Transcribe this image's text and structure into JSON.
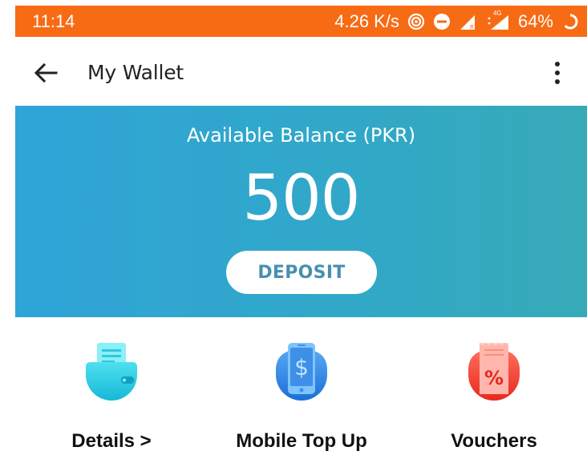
{
  "status_bar": {
    "time": "11:14",
    "speed": "4.26 K/s",
    "network_label": "4G",
    "battery": "64%",
    "icons": [
      "hotspot-icon",
      "dnd-icon",
      "signal-icon",
      "signal-4g-icon",
      "battery-icon"
    ]
  },
  "app_bar": {
    "title": "My Wallet",
    "icons": [
      "back-arrow-icon",
      "more-vert-icon"
    ]
  },
  "balance": {
    "label": "Available Balance (PKR)",
    "amount": "500",
    "deposit_label": "DEPOSIT",
    "gradient": [
      "#2fa4d8",
      "#37aab8"
    ]
  },
  "features": [
    {
      "label": "Details >",
      "icon": "wallet-details-icon"
    },
    {
      "label": "Mobile Top Up",
      "icon": "mobile-topup-icon"
    },
    {
      "label": "Vouchers",
      "icon": "voucher-icon"
    }
  ],
  "colors": {
    "status_bar": "#f76b15",
    "deposit_text": "#4a8fb0"
  }
}
